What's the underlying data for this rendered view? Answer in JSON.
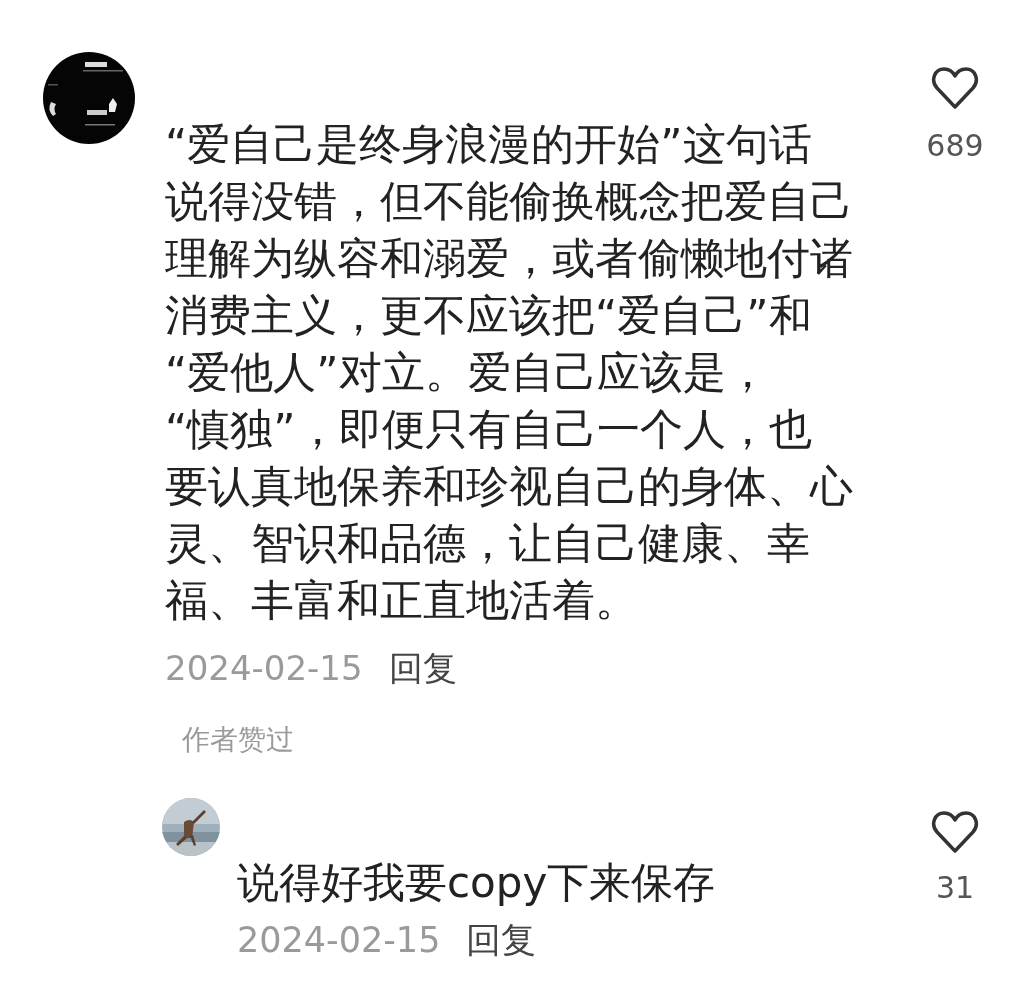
{
  "comments": [
    {
      "kind": "top",
      "avatar": {
        "kind": "picture"
      },
      "lines": [
        "“爱自己是终身浪漫的开始”这句话",
        "说得没错，但不能偷换概念把爱自己",
        "理解为纵容和溺爱，或者偷懒地付诸",
        "消费主义，更不应该把“爱自己”和",
        "“爱他人”对立。爱自己应该是，",
        "“慎独”，即便只有自己一个人，也",
        "要认真地保养和珍视自己的身体、心",
        "灵、智识和品德，让自己健康、幸",
        "福、丰富和正直地活着。"
      ],
      "date": "2024-02-15",
      "reply": "回复",
      "author_liked": "作者赞过",
      "liked": false,
      "likes": "689"
    },
    {
      "kind": "reply",
      "avatar": {
        "kind": "picture"
      },
      "lines": [
        "说得好我要copy下来保存"
      ],
      "date": "2024-02-15",
      "reply": "回复",
      "liked": false,
      "likes": "31"
    }
  ]
}
